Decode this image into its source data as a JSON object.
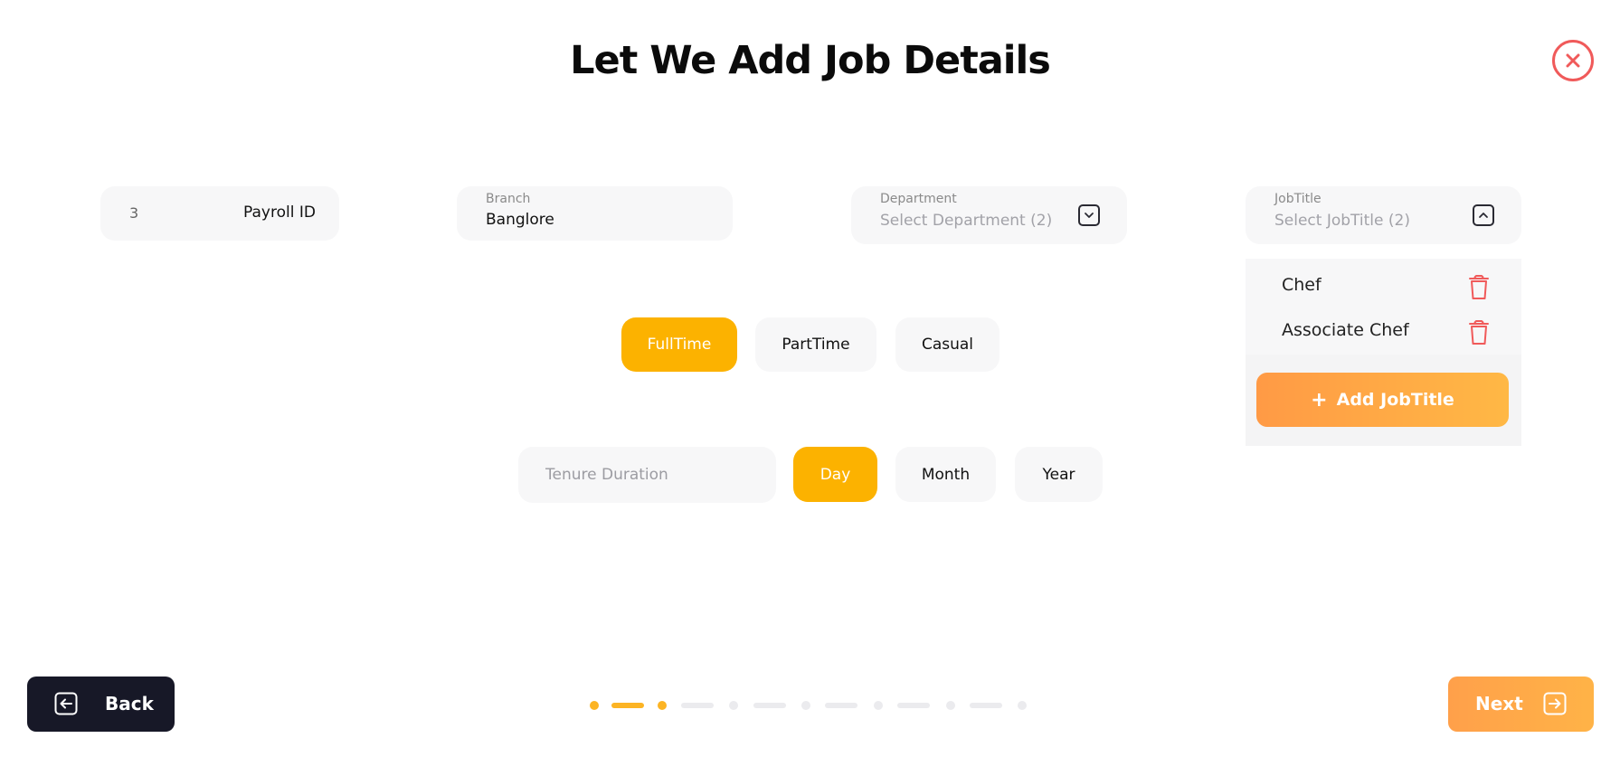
{
  "page": {
    "title": "Let We Add Job Details"
  },
  "payroll": {
    "value": "3",
    "label": "Payroll ID"
  },
  "branch": {
    "label": "Branch",
    "value": "Banglore"
  },
  "department": {
    "label": "Department",
    "placeholder": "Select Department (2)"
  },
  "job_title": {
    "label": "JobTitle",
    "placeholder": "Select JobTitle (2)",
    "items": [
      {
        "name": "Chef"
      },
      {
        "name": "Associate Chef"
      }
    ],
    "add_label": "Add JobTitle",
    "add_icon": "plus-icon"
  },
  "employment_type": {
    "options": [
      "FullTime",
      "PartTime",
      "Casual"
    ],
    "selected": "FullTime"
  },
  "tenure": {
    "placeholder": "Tenure Duration",
    "units": [
      "Day",
      "Month",
      "Year"
    ],
    "selected_unit": "Day"
  },
  "footer": {
    "back_label": "Back",
    "next_label": "Next"
  },
  "progress": {
    "current_step": 2,
    "total_steps": 7
  },
  "colors": {
    "accent": "#fcb200",
    "accent_gradient_start": "#ff9a45",
    "accent_gradient_end": "#ffb845",
    "close_red": "#f05a5a",
    "dark_button": "#171827",
    "field_bg": "#f7f7f8"
  }
}
